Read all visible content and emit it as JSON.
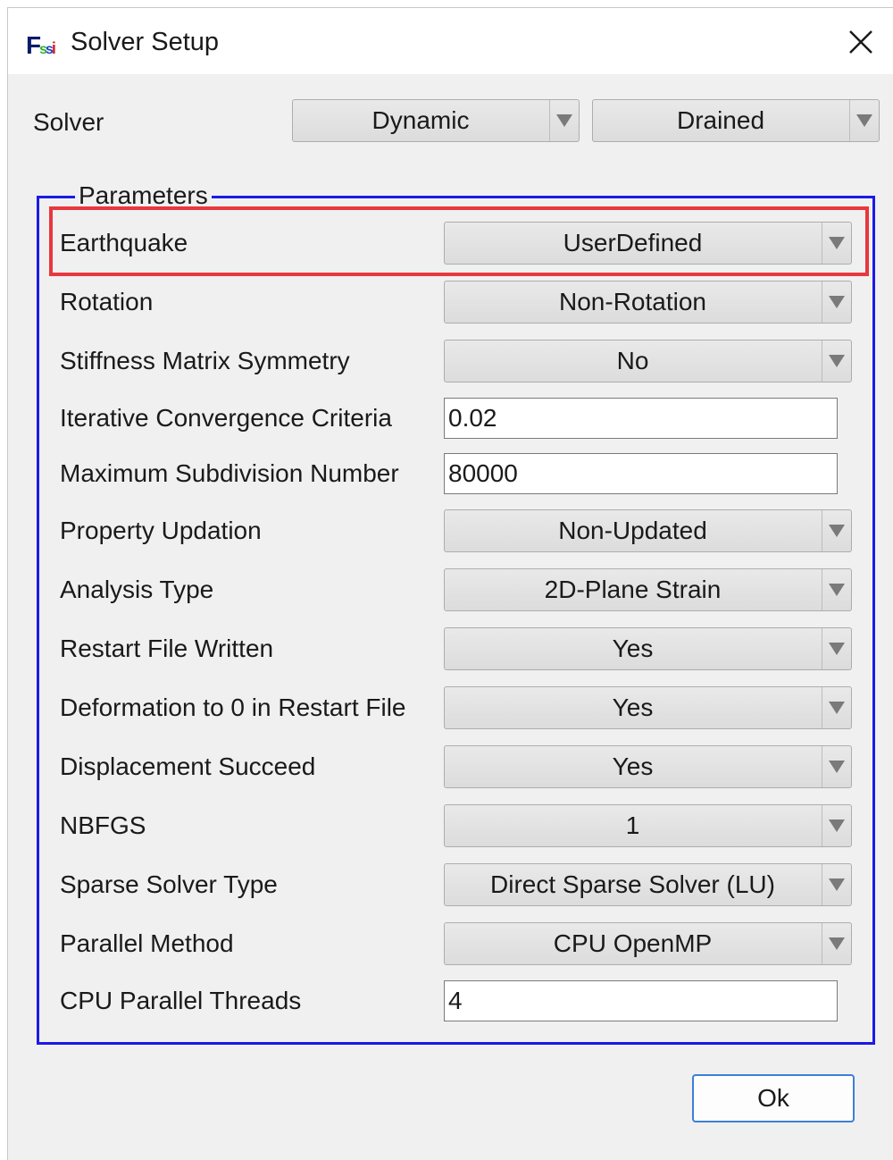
{
  "window": {
    "title": "Solver Setup",
    "icon_letters": {
      "f": "F",
      "s1": "s",
      "s2": "s",
      "i": "i"
    }
  },
  "solver": {
    "label": "Solver",
    "mode": "Dynamic",
    "condition": "Drained"
  },
  "parameters": {
    "title": "Parameters",
    "rows": [
      {
        "label": "Earthquake",
        "type": "combo",
        "value": "UserDefined"
      },
      {
        "label": "Rotation",
        "type": "combo",
        "value": "Non-Rotation"
      },
      {
        "label": "Stiffness Matrix Symmetry",
        "type": "combo",
        "value": "No"
      },
      {
        "label": "Iterative Convergence Criteria",
        "type": "input",
        "value": "0.02"
      },
      {
        "label": "Maximum Subdivision Number",
        "type": "input",
        "value": "80000"
      },
      {
        "label": "Property Updation",
        "type": "combo",
        "value": "Non-Updated"
      },
      {
        "label": "Analysis Type",
        "type": "combo",
        "value": "2D-Plane Strain"
      },
      {
        "label": "Restart File Written",
        "type": "combo",
        "value": "Yes"
      },
      {
        "label": "Deformation to 0 in Restart File",
        "type": "combo",
        "value": "Yes"
      },
      {
        "label": "Displacement Succeed",
        "type": "combo",
        "value": "Yes"
      },
      {
        "label": "NBFGS",
        "type": "combo",
        "value": "1"
      },
      {
        "label": "Sparse Solver Type",
        "type": "combo",
        "value": "Direct Sparse Solver (LU)"
      },
      {
        "label": "Parallel Method",
        "type": "combo",
        "value": "CPU OpenMP"
      },
      {
        "label": "CPU Parallel Threads",
        "type": "input",
        "value": "4"
      }
    ]
  },
  "buttons": {
    "ok": "Ok"
  },
  "colors": {
    "groupbox_border": "#1a1ae6",
    "highlight_border": "#e8373f",
    "ok_border": "#3c7fd8"
  }
}
